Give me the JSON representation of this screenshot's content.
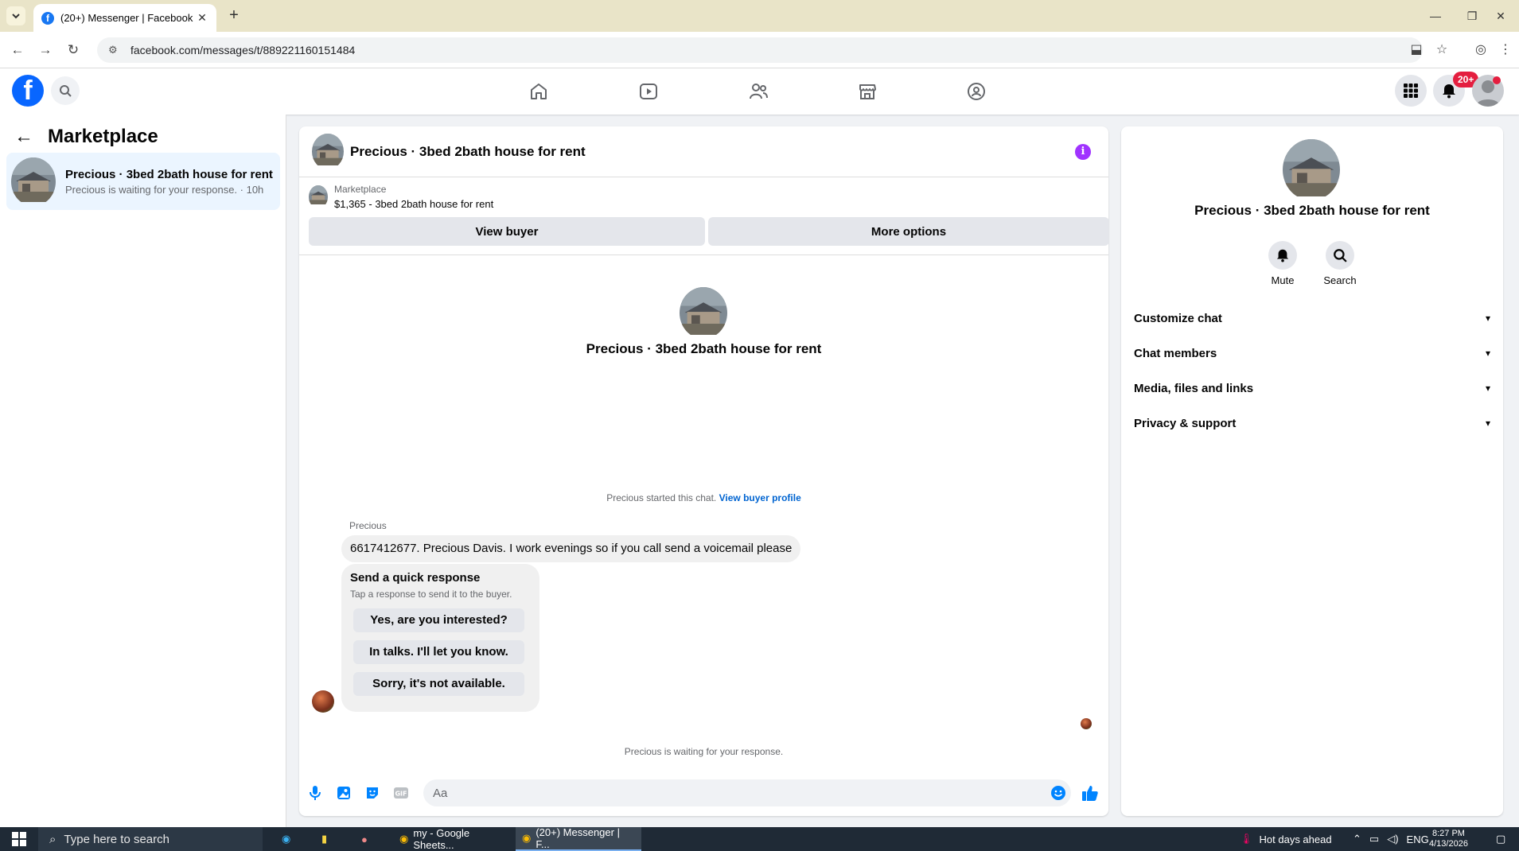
{
  "browser": {
    "tab_title": "(20+) Messenger | Facebook",
    "url": "facebook.com/messages/t/889221160151484"
  },
  "fb_nav": {
    "notification_badge": "20+",
    "icons": [
      "home-icon",
      "video-icon",
      "friends-icon",
      "marketplace-icon",
      "groups-icon"
    ]
  },
  "left_panel": {
    "title": "Marketplace",
    "items": [
      {
        "name": "Precious · 3bed 2bath house for rent",
        "subtitle": "Precious is waiting for your response. · 10h"
      }
    ]
  },
  "chat": {
    "header_title": "Precious · 3bed 2bath house for rent",
    "marketplace_label": "Marketplace",
    "listing": "$1,365 - 3bed 2bath house for rent",
    "view_buyer": "View buyer",
    "more_options": "More options",
    "conversation_title": "Precious · 3bed 2bath house for rent",
    "started_text": "Precious started this chat.",
    "view_buyer_profile": "View buyer profile",
    "sender_name": "Precious",
    "message": "6617412677. Precious Davis. I work evenings so if you call send a voicemail please",
    "quick_response": {
      "title": "Send a quick response",
      "subtitle": "Tap a response to send it to the buyer.",
      "options": [
        "Yes, are you interested?",
        "In talks. I'll let you know.",
        "Sorry, it's not available."
      ]
    },
    "waiting_text": "Precious is waiting for your response.",
    "composer_placeholder": "Aa"
  },
  "right_panel": {
    "title": "Precious · 3bed 2bath house for rent",
    "mute": "Mute",
    "search": "Search",
    "sections": [
      "Customize chat",
      "Chat members",
      "Media, files and links",
      "Privacy & support"
    ]
  },
  "taskbar": {
    "search_placeholder": "Type here to search",
    "apps": [
      "my - Google Sheets...",
      "(20+) Messenger | F..."
    ],
    "weather": "Hot days ahead",
    "language": "ENG",
    "time": "8:27 PM",
    "date": "4/13/2026"
  },
  "colors": {
    "fb_blue": "#0866ff",
    "messenger_blue": "#0084ff",
    "info_purple": "#a033ff",
    "badge_red": "#e41e3f",
    "selected_bg": "#ebf5ff"
  }
}
